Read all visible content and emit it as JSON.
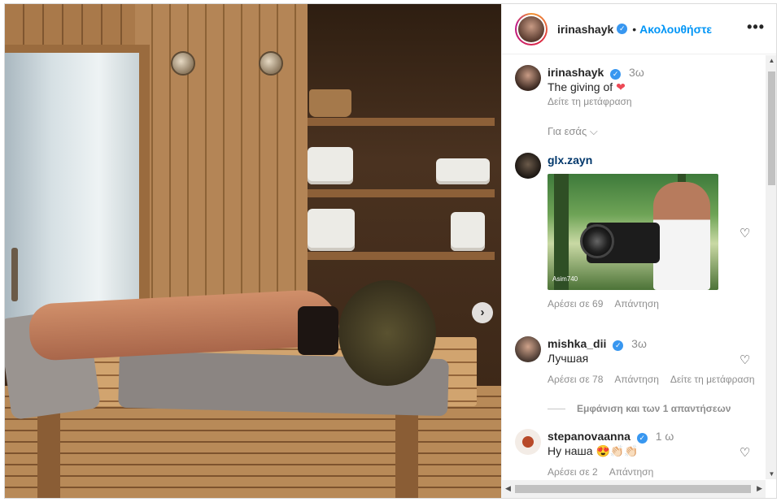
{
  "header": {
    "username": "irinashayk",
    "verified_mark": "✓",
    "separator": "•",
    "follow_label": "Ακολουθήστε",
    "more_label": "•••"
  },
  "photo": {
    "next_label": "›"
  },
  "caption": {
    "username": "irinashayk",
    "time": "3ω",
    "text": "The giving of",
    "heart": "❤",
    "translate": "Δείτε τη μετάφραση",
    "for_you": "Για εσάς ⌵"
  },
  "comments": [
    {
      "username": "glx.zayn",
      "gif_tag": "Asim740",
      "likes": "Αρέσει σε 69",
      "reply": "Απάντηση",
      "heart": "♡"
    },
    {
      "username": "mishka_dii",
      "verified_mark": "✓",
      "time": "3ω",
      "text": "Лучшая",
      "likes": "Αρέσει σε 78",
      "reply": "Απάντηση",
      "translate": "Δείτε τη μετάφραση",
      "heart": "♡"
    },
    {
      "username": "stepanovaanna",
      "verified_mark": "✓",
      "time": "1 ω",
      "text": "Ну наша",
      "emoji": "😍👏🏻👏🏻",
      "likes": "Αρέσει σε 2",
      "reply": "Απάντηση",
      "heart": "♡"
    }
  ],
  "view_replies": "Εμφάνιση και των 1 απαντήσεων",
  "scrollbar": {
    "up": "▲",
    "down": "▼",
    "left": "◀",
    "right": "▶"
  }
}
